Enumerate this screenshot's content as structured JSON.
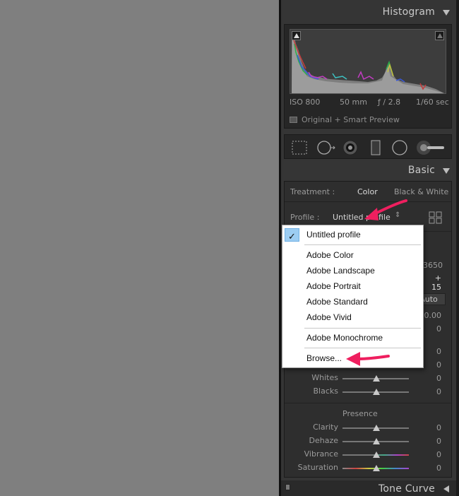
{
  "histogram": {
    "title": "Histogram",
    "iso": "ISO 800",
    "focal": "50 mm",
    "aperture": "ƒ / 2.8",
    "shutter": "1/60 sec",
    "preview_label": "Original + Smart Preview"
  },
  "tools": [
    "crop-overlay-icon",
    "spot-removal-icon",
    "red-eye-icon",
    "graduated-filter-icon",
    "radial-filter-icon",
    "adjustment-brush-icon"
  ],
  "basic": {
    "title": "Basic",
    "treatment_label": "Treatment :",
    "treatment_color": "Color",
    "treatment_bw": "Black & White",
    "profile_label": "Profile :",
    "profile_value": "Untitled profile",
    "temp_value": "3650",
    "tint_value": "+ 15",
    "auto_label": "Auto",
    "exposure_value": "0.00",
    "contrast_value": "0",
    "highlights_value": "0",
    "shadows_value": "0",
    "whites_label": "Whites",
    "whites_value": "0",
    "blacks_label": "Blacks",
    "blacks_value": "0",
    "presence_label": "Presence",
    "clarity_label": "Clarity",
    "clarity_value": "0",
    "dehaze_label": "Dehaze",
    "dehaze_value": "0",
    "vibrance_label": "Vibrance",
    "vibrance_value": "0",
    "saturation_label": "Saturation",
    "saturation_value": "0"
  },
  "tone_curve": {
    "title": "Tone Curve"
  },
  "profile_menu": {
    "selected": "Untitled profile",
    "items": [
      "Adobe Color",
      "Adobe Landscape",
      "Adobe Portrait",
      "Adobe Standard",
      "Adobe Vivid"
    ],
    "monochrome": "Adobe Monochrome",
    "browse": "Browse..."
  },
  "colors": {
    "canvas": "#7f7f7f",
    "panel": "#353535",
    "annotation_arrow": "#ef1f5f",
    "menu_check_bg": "#9ccdf2"
  }
}
